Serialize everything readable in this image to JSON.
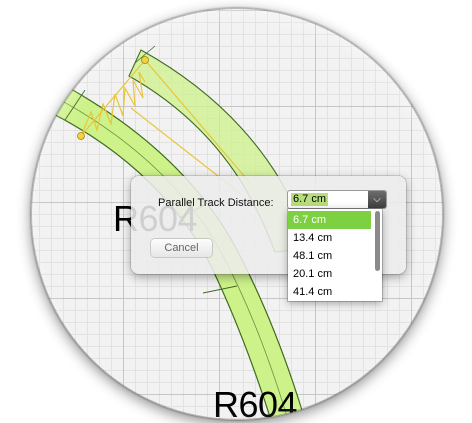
{
  "canvas": {
    "track_labels": [
      "R604",
      "R604"
    ]
  },
  "dialog": {
    "field_label": "Parallel Track Distance:",
    "field_value": "6.7 cm",
    "dropdown_icon": "chevron-down-icon",
    "cancel_label": "Cancel"
  },
  "dropdown": {
    "options": [
      "6.7 cm",
      "13.4 cm",
      "48.1 cm",
      "20.1 cm",
      "41.4 cm"
    ],
    "selected_index": 0
  },
  "colors": {
    "track_fill": "#cef28a",
    "track_outline": "#3f6a1f",
    "selection_highlight": "#7ed043",
    "spring": "#e8c53a"
  }
}
